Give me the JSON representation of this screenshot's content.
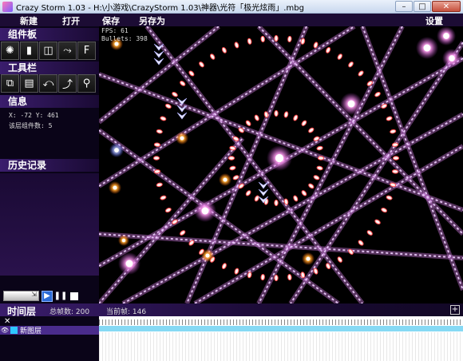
{
  "window": {
    "title": "Crazy Storm 1.03 - H:\\小游戏\\CrazyStorm 1.03\\神器\\光符「极光炫雨」.mbg",
    "minimize": "–",
    "maximize": "□",
    "close": "✕"
  },
  "menu": {
    "new": "新建",
    "open": "打开",
    "save": "保存",
    "save_as": "另存为",
    "settings": "设置"
  },
  "components": {
    "title": "组件板",
    "tools": [
      {
        "icon": "emitter-icon",
        "glyph": "✺"
      },
      {
        "icon": "laser-icon",
        "glyph": "▮"
      },
      {
        "icon": "mask-icon",
        "glyph": "◫"
      },
      {
        "icon": "rebound-icon",
        "glyph": "⤳"
      },
      {
        "icon": "force-field-icon",
        "glyph": "F"
      }
    ]
  },
  "toolbar": {
    "title": "工具栏",
    "tools": [
      {
        "icon": "copy-icon",
        "glyph": "⧉"
      },
      {
        "icon": "paste-icon",
        "glyph": "▤"
      },
      {
        "icon": "undo-icon",
        "glyph": "⤺"
      },
      {
        "icon": "redo-icon",
        "glyph": "⤴"
      },
      {
        "icon": "zoom-icon",
        "glyph": "⚲"
      }
    ]
  },
  "info": {
    "title": "信息",
    "coords": "X: -72  Y: 461",
    "layer_count": "该层组件数: 5"
  },
  "history": {
    "title": "历史记录"
  },
  "canvas": {
    "fps": "FPS: 61",
    "bullets": "Bullets: 398"
  },
  "timeline": {
    "title": "时间层",
    "total_frames": "总帧数: 200",
    "current_frame": "当前帧: 146",
    "add": "+",
    "close": "✕",
    "layers": [
      {
        "name": "新图层",
        "color": "#2ec8ff"
      }
    ]
  },
  "colors": {
    "panel": "#0a0418",
    "header": "#3a1d6c",
    "laser": "#e8b4f0",
    "bullet_core": "#ffffff",
    "orb": "#ffa830"
  }
}
